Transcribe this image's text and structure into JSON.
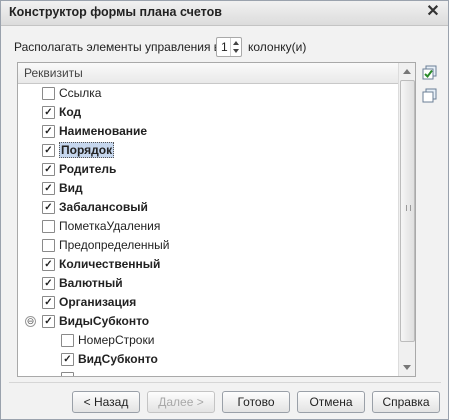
{
  "window": {
    "title": "Конструктор формы плана счетов",
    "close_label": "✕"
  },
  "layout_control": {
    "prefix": "Располагать элементы управления в",
    "value": "1",
    "suffix": "колонку(и)"
  },
  "tree": {
    "header": "Реквизиты",
    "rows": [
      {
        "label": "Ссылка",
        "checked": false,
        "bold": false,
        "indent": 0,
        "selected": false
      },
      {
        "label": "Код",
        "checked": true,
        "bold": true,
        "indent": 0,
        "selected": false
      },
      {
        "label": "Наименование",
        "checked": true,
        "bold": true,
        "indent": 0,
        "selected": false
      },
      {
        "label": "Порядок",
        "checked": true,
        "bold": true,
        "indent": 0,
        "selected": true
      },
      {
        "label": "Родитель",
        "checked": true,
        "bold": true,
        "indent": 0,
        "selected": false
      },
      {
        "label": "Вид",
        "checked": true,
        "bold": true,
        "indent": 0,
        "selected": false
      },
      {
        "label": "Забалансовый",
        "checked": true,
        "bold": true,
        "indent": 0,
        "selected": false
      },
      {
        "label": "ПометкаУдаления",
        "checked": false,
        "bold": false,
        "indent": 0,
        "selected": false
      },
      {
        "label": "Предопределенный",
        "checked": false,
        "bold": false,
        "indent": 0,
        "selected": false
      },
      {
        "label": "Количественный",
        "checked": true,
        "bold": true,
        "indent": 0,
        "selected": false
      },
      {
        "label": "Валютный",
        "checked": true,
        "bold": true,
        "indent": 0,
        "selected": false
      },
      {
        "label": "Организация",
        "checked": true,
        "bold": true,
        "indent": 0,
        "selected": false
      },
      {
        "label": "ВидыСубконто",
        "checked": true,
        "bold": true,
        "indent": 0,
        "selected": false,
        "expander": "⊖"
      },
      {
        "label": "НомерСтроки",
        "checked": false,
        "bold": false,
        "indent": 1,
        "selected": false
      },
      {
        "label": "ВидСубконто",
        "checked": true,
        "bold": true,
        "indent": 1,
        "selected": false
      },
      {
        "label": "",
        "checked": false,
        "bold": false,
        "indent": 1,
        "selected": false
      }
    ]
  },
  "buttons": {
    "back": "< Назад",
    "next": "Далее >",
    "done": "Готово",
    "cancel": "Отмена",
    "help": "Справка"
  },
  "check_glyph": "✓",
  "icons": [
    "check-all-icon",
    "uncheck-all-icon"
  ]
}
